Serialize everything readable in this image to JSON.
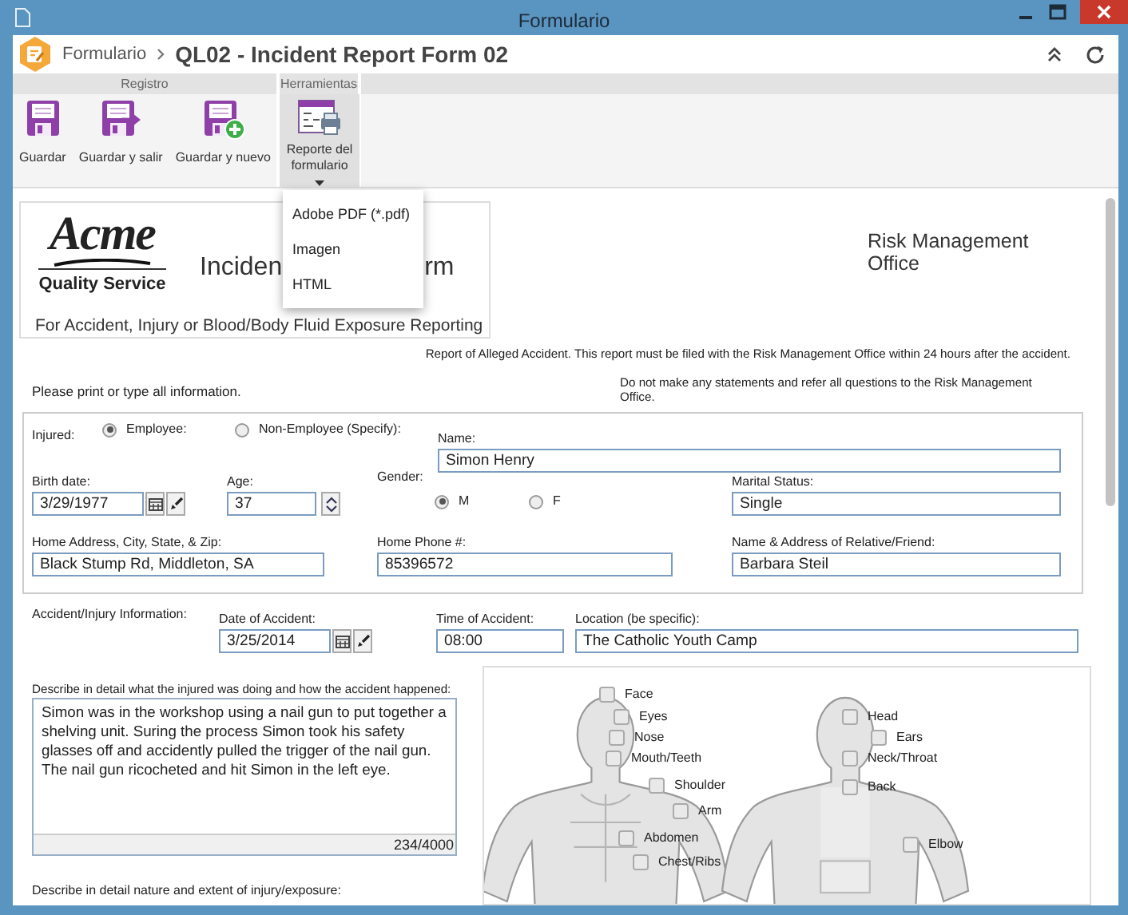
{
  "window": {
    "title": "Formulario"
  },
  "header": {
    "breadcrumb": "Formulario",
    "title": "QL02 - Incident Report Form 02"
  },
  "ribbon": {
    "groups": [
      {
        "label": "Registro",
        "buttons": [
          {
            "kind": "save",
            "label": "Guardar"
          },
          {
            "kind": "save-exit",
            "label": "Guardar y salir"
          },
          {
            "kind": "save-new",
            "label": "Guardar y nuevo"
          }
        ]
      },
      {
        "label": "Herramientas",
        "buttons": [
          {
            "kind": "report",
            "label": "Reporte del formulario",
            "expanded": true
          }
        ]
      }
    ]
  },
  "dropdown_menu": {
    "items": [
      "Adobe PDF (*.pdf)",
      "Imagen",
      "HTML"
    ]
  },
  "form": {
    "logo": {
      "name": "Acme",
      "tagline": "Quality Service"
    },
    "title_parts": [
      "Inciden",
      "rm"
    ],
    "subtitle": "For Accident, Injury or Blood/Body Fluid Exposure Reporting",
    "office": "Risk Management Office",
    "notice": "Report of Alleged Accident. This report must be filed with the Risk Management Office within 24 hours after the accident.",
    "instruction": "Please print or type all information.",
    "warning": "Do not make any statements and refer all questions to the Risk Management Office."
  },
  "injured": {
    "label": "Injured:",
    "options": [
      {
        "label": "Employee:",
        "selected": true
      },
      {
        "label": "Non-Employee (Specify):",
        "selected": false
      }
    ]
  },
  "name": {
    "label": "Name:",
    "value": "Simon Henry"
  },
  "birth_date": {
    "label": "Birth date:",
    "value": "3/29/1977"
  },
  "age": {
    "label": "Age:",
    "value": "37"
  },
  "gender": {
    "label": "Gender:",
    "options": [
      {
        "label": "M",
        "selected": true
      },
      {
        "label": "F",
        "selected": false
      }
    ]
  },
  "marital_status": {
    "label": "Marital Status:",
    "value": "Single"
  },
  "home_address": {
    "label": "Home Address, City, State, & Zip:",
    "value": "Black Stump Rd, Middleton, SA"
  },
  "home_phone": {
    "label": "Home Phone #:",
    "value": "85396572"
  },
  "relative": {
    "label": "Name & Address of Relative/Friend:",
    "value": "Barbara Steil"
  },
  "accident": {
    "label": "Accident/Injury Information:",
    "date": {
      "label": "Date of Accident:",
      "value": "3/25/2014"
    },
    "time": {
      "label": "Time of Accident:",
      "value": "08:00"
    },
    "location": {
      "label": "Location (be specific):",
      "value": "The Catholic Youth Camp"
    }
  },
  "description": {
    "label": "Describe in detail what the injured was doing and how the accident happened:",
    "value": "Simon was in the workshop using a nail gun to put together a shelving unit. Suring the process Simon took his safety glasses off and accidently pulled the trigger of the nail gun. The nail gun ricocheted and hit Simon in the left eye.",
    "counter": "234/4000"
  },
  "body_parts": [
    {
      "label": "Face",
      "checked": false
    },
    {
      "label": "Eyes",
      "checked": false
    },
    {
      "label": "Nose",
      "checked": false
    },
    {
      "label": "Mouth/Teeth",
      "checked": false
    },
    {
      "label": "Shoulder",
      "checked": false
    },
    {
      "label": "Arm",
      "checked": false
    },
    {
      "label": "Abdomen",
      "checked": false
    },
    {
      "label": "Chest/Ribs",
      "checked": false
    },
    {
      "label": "Head",
      "checked": false
    },
    {
      "label": "Ears",
      "checked": false
    },
    {
      "label": "Neck/Throat",
      "checked": false
    },
    {
      "label": "Back",
      "checked": false
    },
    {
      "label": "Elbow",
      "checked": false
    }
  ],
  "injury_label": "Describe in detail nature and extent of injury/exposure:"
}
